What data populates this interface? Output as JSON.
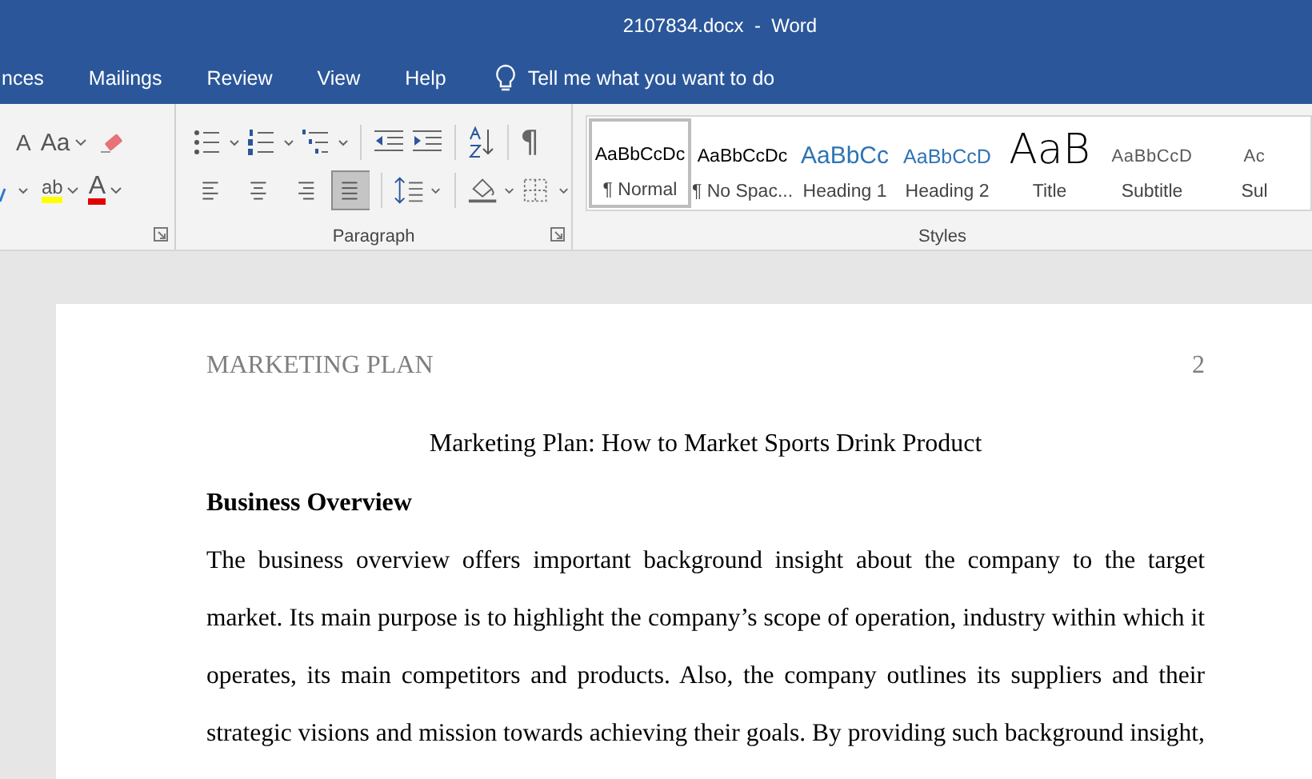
{
  "window": {
    "title": "2107834.docx  -  Word"
  },
  "tabs": [
    {
      "label": "nces",
      "selected": false
    },
    {
      "label": "Mailings",
      "selected": false
    },
    {
      "label": "Review",
      "selected": false
    },
    {
      "label": "View",
      "selected": false
    },
    {
      "label": "Help",
      "selected": false
    }
  ],
  "tell_me": {
    "placeholder": "Tell me what you want to do"
  },
  "font_group": {
    "grow_font": "A",
    "change_case": "Aa",
    "highlight": "ab",
    "font_color": "A"
  },
  "paragraph_group": {
    "label": "Paragraph",
    "pilcrow": "¶",
    "alignments": [
      {
        "kind": "left",
        "selected": false
      },
      {
        "kind": "center",
        "selected": false
      },
      {
        "kind": "right",
        "selected": false
      },
      {
        "kind": "justify",
        "selected": true
      }
    ]
  },
  "styles_group": {
    "label": "Styles",
    "styles": [
      {
        "preview": "AaBbCcDc",
        "name": "¶ Normal",
        "kind": "normal",
        "selected": true
      },
      {
        "preview": "AaBbCcDc",
        "name": "¶ No Spac...",
        "kind": "nospace",
        "selected": false
      },
      {
        "preview": "AaBbCc",
        "name": "Heading 1",
        "kind": "heading1",
        "selected": false
      },
      {
        "preview": "AaBbCcD",
        "name": "Heading 2",
        "kind": "heading2",
        "selected": false
      },
      {
        "preview": "AaB",
        "name": "Title",
        "kind": "title",
        "selected": false
      },
      {
        "preview": "AaBbCcD",
        "name": "Subtitle",
        "kind": "subtitle",
        "selected": false
      },
      {
        "preview": "Ac",
        "name": "Sul",
        "kind": "subtle",
        "selected": false
      }
    ]
  },
  "document": {
    "header_title": "MARKETING PLAN",
    "page_number": "2",
    "title": "Marketing Plan: How to Market Sports Drink Product",
    "heading": "Business Overview",
    "paragraph": "The business overview offers important background insight about the company to the target market. Its main purpose is to highlight the company’s scope of operation, industry within which it operates, its main competitors and products. Also, the company outlines its suppliers and their strategic visions and mission towards achieving their goals. By providing such background insight,"
  }
}
